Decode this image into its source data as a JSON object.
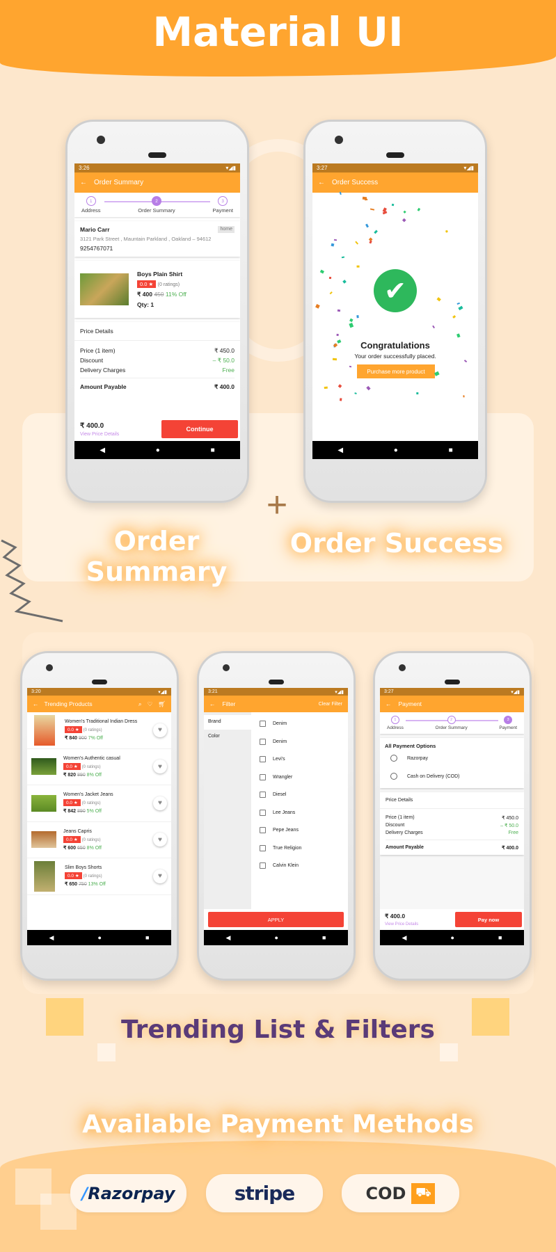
{
  "banner": {
    "title": "Material UI"
  },
  "colors": {
    "primary": "#ffa52f",
    "status_bar": "#bb7a21",
    "accent": "#f44336",
    "step": "#b77ee6",
    "green": "#4caf50"
  },
  "sections": {
    "order_summary_label": "Order Summary",
    "order_success_label": "Order Success",
    "plus": "+",
    "trending_label": "Trending List & Filters",
    "payments_label": "Available Payment Methods"
  },
  "payment_methods": [
    {
      "name": "Razorpay",
      "icon": "razorpay-logo"
    },
    {
      "name": "stripe",
      "icon": "stripe-logo"
    },
    {
      "name": "COD",
      "icon": "delivery-truck-icon"
    }
  ],
  "steps": [
    "Address",
    "Order Summary",
    "Payment"
  ],
  "order_summary": {
    "time": "3:26",
    "title": "Order Summary",
    "active_step": 2,
    "address": {
      "name": "Mario Carr",
      "tag": "home",
      "line": "3121 Park Street ,  Mauntain Parkland ,  Oakland  –  94612",
      "phone": "9254767071"
    },
    "product": {
      "name": "Boys Plain Shirt",
      "rating": "0.0 ★",
      "ratings_count": "(0 ratings)",
      "price": "₹ 400",
      "mrp": "450",
      "off": "11% Off",
      "qty": "Qty: 1"
    },
    "price_details": {
      "title": "Price Details",
      "rows": [
        {
          "label": "Price  (1 item)",
          "value": "₹ 450.0",
          "color": "default"
        },
        {
          "label": "Discount",
          "value": "– ₹ 50.0",
          "color": "green"
        },
        {
          "label": "Delivery Charges",
          "value": "Free",
          "color": "green"
        }
      ],
      "total_label": "Amount Payable",
      "total_value": "₹ 400.0"
    },
    "footer": {
      "total": "₹ 400.0",
      "link": "View Price Details",
      "button": "Continue"
    }
  },
  "order_success": {
    "time": "3:27",
    "title": "Order Success",
    "heading": "Congratulations",
    "message": "Your order successfully placed.",
    "button": "Purchase more product"
  },
  "trending": {
    "time": "3:20",
    "title": "Trending Products",
    "products": [
      {
        "name": "Women's Traditional Indian Dress",
        "rating": "0.0 ★",
        "ratings_count": "(0 ratings)",
        "price": "₹ 840",
        "mrp": "900",
        "off": "7% Off"
      },
      {
        "name": "Women's Authentic casual",
        "rating": "0.0 ★",
        "ratings_count": "(0 ratings)",
        "price": "₹ 820",
        "mrp": "890",
        "off": "8% Off"
      },
      {
        "name": "Women's Jacket Jeans",
        "rating": "0.0 ★",
        "ratings_count": "(0 ratings)",
        "price": "₹ 842",
        "mrp": "890",
        "off": "5% Off"
      },
      {
        "name": "Jeans Capris",
        "rating": "0.0 ★",
        "ratings_count": "(0 ratings)",
        "price": "₹ 600",
        "mrp": "650",
        "off": "8% Off"
      },
      {
        "name": "Slim Boys Shorts",
        "rating": "0.0 ★",
        "ratings_count": "(0 ratings)",
        "price": "₹ 650",
        "mrp": "750",
        "off": "13% Off"
      }
    ]
  },
  "filter": {
    "time": "3:21",
    "title": "Filter",
    "clear": "Clear Filter",
    "categories": [
      "Brand",
      "Color"
    ],
    "options": [
      "Denim",
      "Denim",
      "Levi's",
      "Wrangler",
      "Diesel",
      "Lee Jeans",
      "Pepe Jeans",
      "True Religion",
      "Calvin Klein"
    ],
    "apply": "APPLY"
  },
  "payment": {
    "time": "3:27",
    "title": "Payment",
    "active_step": 3,
    "options_title": "All Payment Options",
    "options": [
      "Razorpay",
      "Cash on Delivery (COD)"
    ],
    "price_details": {
      "title": "Price Details",
      "rows": [
        {
          "label": "Price (1 item)",
          "value": "₹ 450.0",
          "color": "default"
        },
        {
          "label": "Discount",
          "value": "– ₹ 50.0",
          "color": "green"
        },
        {
          "label": "Delivery Charges",
          "value": "Free",
          "color": "green"
        }
      ],
      "total_label": "Amount Payable",
      "total_value": "₹ 400.0"
    },
    "footer": {
      "total": "₹ 400.0",
      "link": "View Price Details",
      "button": "Pay now"
    }
  }
}
